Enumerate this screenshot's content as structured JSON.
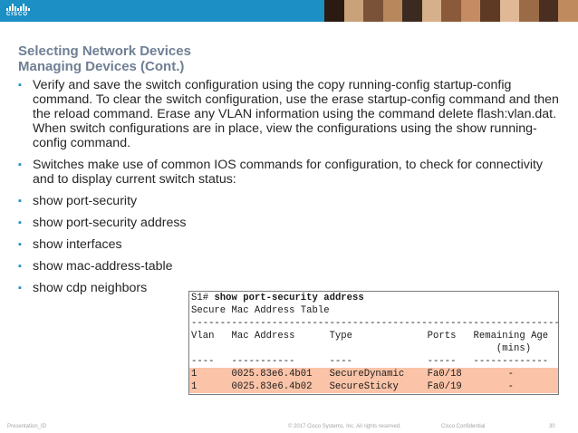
{
  "brand": {
    "logo_text": "CISCO",
    "accent_color": "#1c8fc4",
    "title_color": "#6f7f94",
    "highlight_color": "#fbc4a8"
  },
  "header": {
    "photo_strip_colors": [
      "#2b1a12",
      "#c9a27a",
      "#7a5238",
      "#b8875c",
      "#3b2a20",
      "#d6b08a",
      "#8a5a3a",
      "#c58c63",
      "#5e3a24",
      "#e0b896",
      "#9b6b48",
      "#4a2e1f",
      "#c08a5f"
    ]
  },
  "slide": {
    "title_line1": "Selecting Network Devices",
    "title_line2": "Managing Devices (Cont.)",
    "bullet_glyph": "▪",
    "bullets": [
      "Verify and save the switch configuration using the copy running-config startup-config command. To clear the switch configuration, use the erase startup-config command and then the reload command. Erase any VLAN information using the command delete flash:vlan.dat. When switch configurations are in place, view the configurations using the show running-config command.",
      "Switches make use of common IOS commands for configuration, to check for connectivity and to display current switch status:",
      "show port-security",
      "show port-security address",
      "show interfaces",
      "show mac-address-table",
      "show cdp neighbors"
    ]
  },
  "cli": {
    "prompt": "S1# ",
    "command": "show port-security address",
    "lines": [
      "Secure Mac Address Table",
      "-----------------------------------------------------------------",
      "Vlan   Mac Address      Type             Ports   Remaining Age",
      "                                                     (mins)",
      "----   -----------      ----             -----   -------------",
      "1      0025.83e6.4b01   SecureDynamic    Fa0/18        -",
      "1      0025.83e6.4b02   SecureSticky     Fa0/19        -"
    ]
  },
  "footer": {
    "left": "Presentation_ID",
    "center": "© 2017 Cisco Systems, Inc. All rights reserved.",
    "right": "Cisco Confidential",
    "page": "30"
  }
}
